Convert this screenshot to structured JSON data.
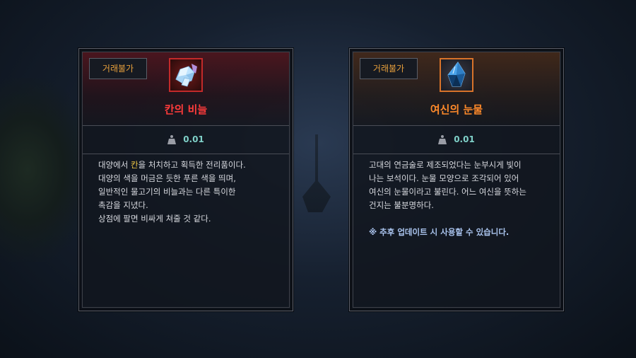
{
  "cards": [
    {
      "badge": "거래불가",
      "icon": "crystal-scale-icon",
      "name": "칸의 비늘",
      "name_color": "#ff3b3b",
      "weight": "0.01",
      "desc_part1": "대양에서 ",
      "desc_highlight": "칸",
      "desc_part2": "을 처치하고 획득한 전리품이다.",
      "desc_lines": [
        "대양의 색을 머금은 듯한 푸른 색을 띄며,",
        "일반적인 물고기의 비늘과는 다른 특이한",
        "촉감을 지녔다.",
        "상점에 팔면 비싸게 쳐줄 것 같다."
      ]
    },
    {
      "badge": "거래불가",
      "icon": "blue-tear-gem-icon",
      "name": "여신의 눈물",
      "name_color": "#ff8a2a",
      "weight": "0.01",
      "desc_lines": [
        "고대의 연금술로 제조되었다는 눈부시게 빛이",
        "나는 보석이다. 눈물 모양으로 조각되어 있어",
        "여신의 눈물이라고 불린다. 어느 여신을 뜻하는",
        "건지는 불분명하다."
      ],
      "note": "※ 추후 업데이트 시 사용할 수 있습니다."
    }
  ]
}
